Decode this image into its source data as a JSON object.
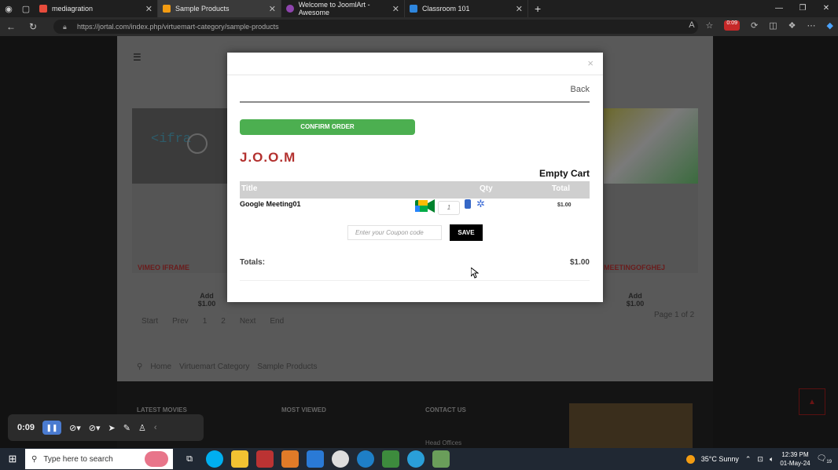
{
  "browser": {
    "tabs": [
      {
        "label": "mediagration",
        "color": "#e74c3c"
      },
      {
        "label": "Sample Products",
        "color": "#f39c12",
        "active": true
      },
      {
        "label": "Welcome to JoomlArt - Awesome",
        "color": "#8e44ad"
      },
      {
        "label": "Classroom 101",
        "color": "#2e86de"
      }
    ],
    "url": "https://jortal.com/index.php/virtuemart-category/sample-products",
    "badge": "0:09"
  },
  "site": {
    "products": [
      {
        "name": "VIMEO IFRAME",
        "add_label": "Add",
        "price": "$1.00"
      },
      {
        "name": "MEETINGOFGHEJ",
        "add_label": "Add",
        "price": "$1.00"
      }
    ],
    "iframe_text": "<ifra",
    "pager": [
      "Start",
      "Prev",
      "1",
      "2",
      "Next",
      "End"
    ],
    "page_count": "Page 1 of 2",
    "breadcrumbs": [
      "Home",
      "Virtuemart Category",
      "Sample Products"
    ],
    "footer_headings": [
      "LATEST MOVIES",
      "MOST VIEWED",
      "CONTACT US"
    ],
    "footer_contact": "Head Offices"
  },
  "recorder": {
    "time": "0:09"
  },
  "modal": {
    "close": "×",
    "back": "Back",
    "confirm": "CONFIRM ORDER",
    "brand": "J.O.O.M",
    "status": "Empty Cart",
    "table": {
      "headers": [
        "Title",
        "Qty",
        "Total"
      ],
      "row": {
        "title": "Google Meeting01",
        "qty": "1",
        "total": "$1.00"
      }
    },
    "coupon_placeholder": "Enter your Coupon code",
    "save": "SAVE",
    "totals_label": "Totals:",
    "totals_value": "$1.00"
  },
  "taskbar": {
    "search_placeholder": "Type here to search",
    "weather": "35°C  Sunny",
    "time": "12:39 PM",
    "date": "01-May-24",
    "notif_count": "19"
  }
}
